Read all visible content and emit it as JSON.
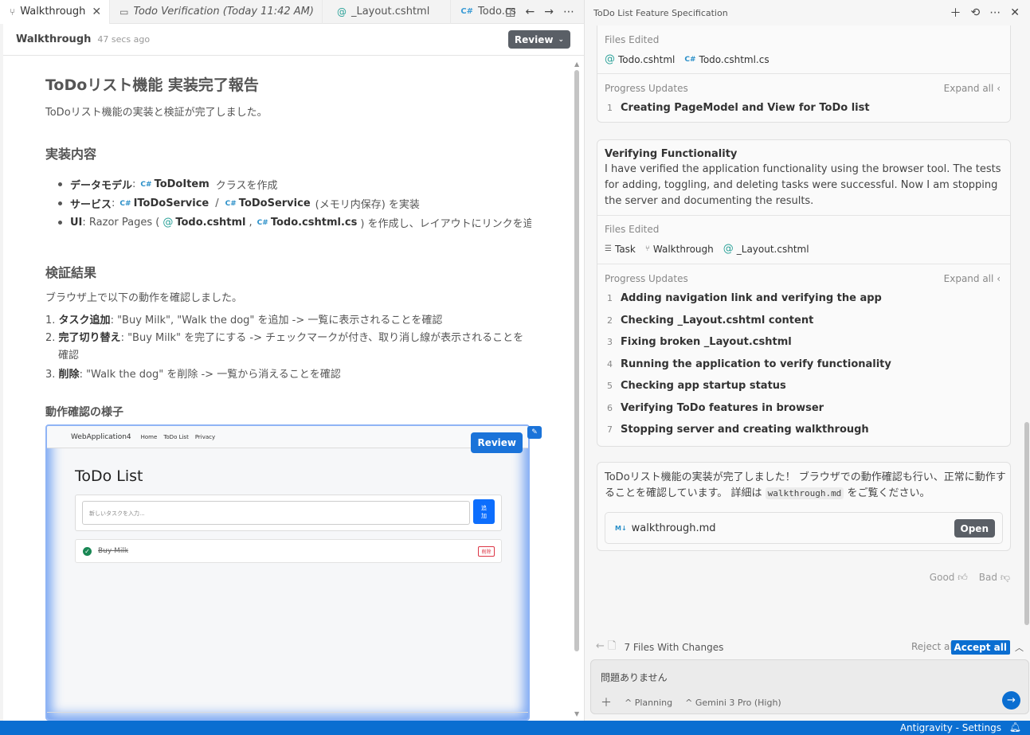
{
  "editor": {
    "tabs": [
      {
        "icon": "walkthrough-icon",
        "label": "Walkthrough",
        "active": true
      },
      {
        "icon": "camera-icon",
        "label": "Todo Verification (Today 11:42 AM)",
        "italic": true
      },
      {
        "icon": "at-icon",
        "label": "_Layout.cshtml"
      },
      {
        "icon": "csharp-icon",
        "label": "Todo.cs"
      }
    ],
    "close_glyph": "✕",
    "subheader": {
      "title": "Walkthrough",
      "time": "47 secs ago",
      "review_label": "Review"
    },
    "doc": {
      "h1": "ToDoリスト機能 実装完了報告",
      "intro": "ToDoリスト機能の実装と検証が完了しました。",
      "impl_heading": "実装内容",
      "bullets": [
        {
          "label": "データモデル",
          "sep": ":",
          "chip1": "ToDoItem",
          "rest": "クラスを作成"
        },
        {
          "label": "サービス",
          "sep": ":",
          "chip1": "IToDoService",
          "mid": "/",
          "chip2": "ToDoService",
          "rest": "(メモリ内保存) を実装"
        },
        {
          "label": "UI",
          "pre": ": Razor Pages (",
          "chip1": "Todo.cshtml",
          "mid": ",",
          "chip2": "Todo.cshtml.cs",
          "rest": ") を作成し、レイアウトにリンクを追加"
        }
      ],
      "verify_heading": "検証結果",
      "verify_intro": "ブラウザ上で以下の動作を確認しました。",
      "numbered": [
        {
          "n": "1.",
          "label": "タスク追加",
          "text": ": \"Buy Milk\", \"Walk the dog\" を追加 -> 一覧に表示されることを確認"
        },
        {
          "n": "2.",
          "label": "完了切り替え",
          "text": ": \"Buy Milk\" を完了にする -> チェックマークが付き、取り消し線が表示されることを確認"
        },
        {
          "n": "3.",
          "label": "削除",
          "text": ": \"Walk the dog\" を削除 -> 一覧から消えることを確認"
        }
      ],
      "demo_heading": "動作確認の様子"
    },
    "screenshot": {
      "brand": "WebApplication4",
      "nav": [
        "Home",
        "ToDo List",
        "Privacy"
      ],
      "review_label": "Review",
      "title": "ToDo List",
      "input_placeholder": "新しいタスクを入力...",
      "add_label": "追加",
      "item": "Buy Milk",
      "delete_label": "削除"
    }
  },
  "panel": {
    "title": "ToDo List Feature Specification",
    "card1": {
      "files_label": "Files Edited",
      "files": [
        {
          "icon": "at",
          "name": "Todo.cshtml"
        },
        {
          "icon": "cs",
          "name": "Todo.cshtml.cs"
        }
      ],
      "progress_label": "Progress Updates",
      "expand_label": "Expand all",
      "steps": [
        "Creating PageModel and View for ToDo list"
      ]
    },
    "card2": {
      "title": "Verifying Functionality",
      "desc": "I have verified the application functionality using the browser tool. The tests for adding, toggling, and deleting tasks were successful. Now I am stopping the server and documenting the results.",
      "files_label": "Files Edited",
      "files": [
        {
          "icon": "task",
          "name": "Task"
        },
        {
          "icon": "walk",
          "name": "Walkthrough"
        },
        {
          "icon": "at",
          "name": "_Layout.cshtml"
        }
      ],
      "progress_label": "Progress Updates",
      "expand_label": "Expand all",
      "steps": [
        "Adding navigation link and verifying the app",
        "Checking _Layout.cshtml content",
        "Fixing broken _Layout.cshtml",
        "Running the application to verify functionality",
        "Checking app startup status",
        "Verifying ToDo features in browser",
        "Stopping server and creating walkthrough"
      ]
    },
    "message": {
      "text_before": "ToDoリスト機能の実装が完了しました！ ブラウザでの動作確認も行い、正常に動作することを確認しています。 詳細は",
      "code": "walkthrough.md",
      "text_after": "をご覧ください。",
      "file": "walkthrough.md",
      "open_label": "Open"
    },
    "feedback": {
      "good": "Good",
      "bad": "Bad"
    },
    "changes": {
      "label": "7 Files With Changes",
      "reject": "Reject all",
      "accept": "Accept all"
    },
    "chat": {
      "value": "問題ありません",
      "mode": "Planning",
      "model": "Gemini 3 Pro (High)"
    }
  },
  "status": {
    "text": "Antigravity - Settings"
  }
}
